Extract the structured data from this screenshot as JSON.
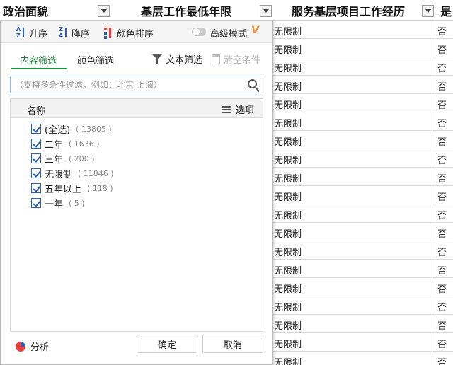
{
  "columns": [
    {
      "label": "政治面貌"
    },
    {
      "label": "基层工作最低年限"
    },
    {
      "label": "服务基层项目工作经历"
    },
    {
      "label": "是"
    }
  ],
  "rows": [
    {
      "c1": "无限制",
      "c2": "否"
    },
    {
      "c1": "无限制",
      "c2": "否"
    },
    {
      "c1": "无限制",
      "c2": "否"
    },
    {
      "c1": "无限制",
      "c2": "否"
    },
    {
      "c1": "无限制",
      "c2": "否"
    },
    {
      "c1": "无限制",
      "c2": "否"
    },
    {
      "c1": "无限制",
      "c2": "否"
    },
    {
      "c1": "无限制",
      "c2": "否"
    },
    {
      "c1": "无限制",
      "c2": "否"
    },
    {
      "c1": "无限制",
      "c2": "否"
    },
    {
      "c1": "无限制",
      "c2": "否"
    },
    {
      "c1": "无限制",
      "c2": "否"
    },
    {
      "c1": "无限制",
      "c2": "否"
    },
    {
      "c1": "无限制",
      "c2": "否"
    },
    {
      "c1": "无限制",
      "c2": "否"
    },
    {
      "c1": "无限制",
      "c2": "否"
    },
    {
      "c1": "无限制",
      "c2": "否"
    },
    {
      "c1": "无限制",
      "c2": "否"
    },
    {
      "c1": "无限制",
      "c2": "否"
    }
  ],
  "popup": {
    "sort": {
      "asc_label": "升序",
      "asc_icon": {
        "top": "A",
        "bottom": "Z"
      },
      "desc_label": "降序",
      "desc_icon": {
        "top": "Z",
        "bottom": "A"
      },
      "color_label": "颜色排序"
    },
    "advanced": {
      "label": "高级模式",
      "enabled": false,
      "badge": "V"
    },
    "tabs": {
      "content": "内容筛选",
      "color": "颜色筛选"
    },
    "text_filter_label": "文本筛选",
    "clear_label": "清空条件",
    "search": {
      "placeholder": "（支持多条件过滤，例如：北京 上海）",
      "value": ""
    },
    "list_header": {
      "name_label": "名称",
      "options_label": "选项"
    },
    "items": [
      {
        "label": "(全选)",
        "count": "( 13805 )",
        "checked": true
      },
      {
        "label": "二年",
        "count": "( 1636 )",
        "checked": true
      },
      {
        "label": "三年",
        "count": "( 200 )",
        "checked": true
      },
      {
        "label": "无限制",
        "count": "( 11846 )",
        "checked": true
      },
      {
        "label": "五年以上",
        "count": "( 118 )",
        "checked": true
      },
      {
        "label": "一年",
        "count": "( 5 )",
        "checked": true
      }
    ],
    "footer": {
      "analysis_label": "分析",
      "ok_label": "确定",
      "cancel_label": "取消"
    }
  },
  "colors": {
    "accent_green": "#2a8a45",
    "link_blue": "#2a5fb8",
    "vip_orange": "#f08a2c"
  }
}
